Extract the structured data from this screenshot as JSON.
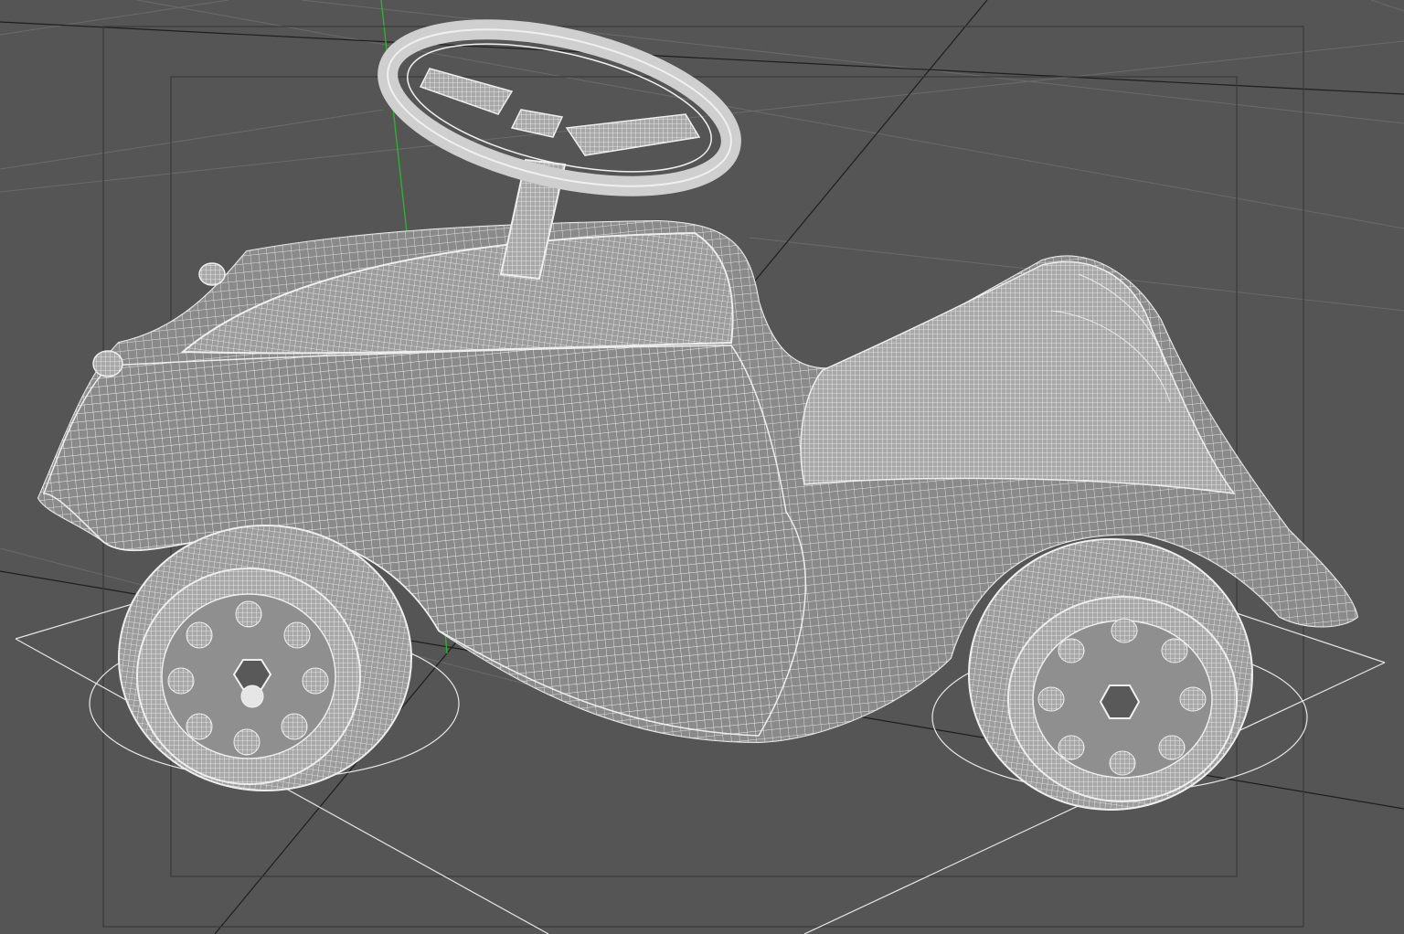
{
  "viewport": {
    "mode": "wireframe",
    "background_color": "#555555",
    "wire_color": "#e9e9e9",
    "grid_color": "#6a6a6a",
    "y_axis_color": "#2fb02f",
    "frame_color": "#3a3a3a"
  },
  "scene": {
    "object": "ride-on-toy-car",
    "parts": [
      "body",
      "steering-wheel",
      "steering-column",
      "front-wheel",
      "rear-wheel",
      "ground-plane"
    ]
  }
}
